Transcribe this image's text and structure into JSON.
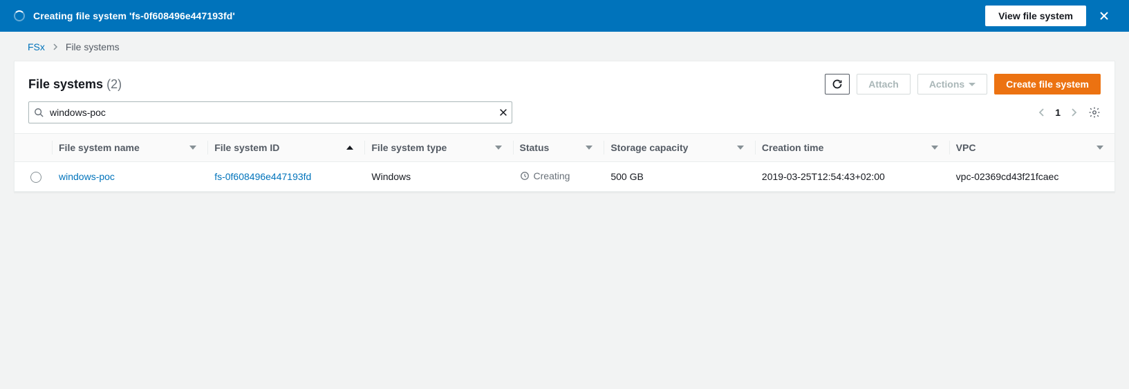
{
  "banner": {
    "message": "Creating file system 'fs-0f608496e447193fd'",
    "view_label": "View file system"
  },
  "breadcrumbs": {
    "root": "FSx",
    "current": "File systems"
  },
  "panel": {
    "title": "File systems",
    "count_display": "(2)",
    "buttons": {
      "attach": "Attach",
      "actions": "Actions",
      "create": "Create file system"
    }
  },
  "search": {
    "value": "windows-poc"
  },
  "pagination": {
    "page": "1"
  },
  "columns": {
    "name": "File system name",
    "id": "File system ID",
    "type": "File system type",
    "status": "Status",
    "storage": "Storage capacity",
    "created": "Creation time",
    "vpc": "VPC"
  },
  "rows": [
    {
      "name": "windows-poc",
      "id": "fs-0f608496e447193fd",
      "type": "Windows",
      "status": "Creating",
      "storage": "500 GB",
      "created": "2019-03-25T12:54:43+02:00",
      "vpc": "vpc-02369cd43f21fcaec"
    }
  ]
}
